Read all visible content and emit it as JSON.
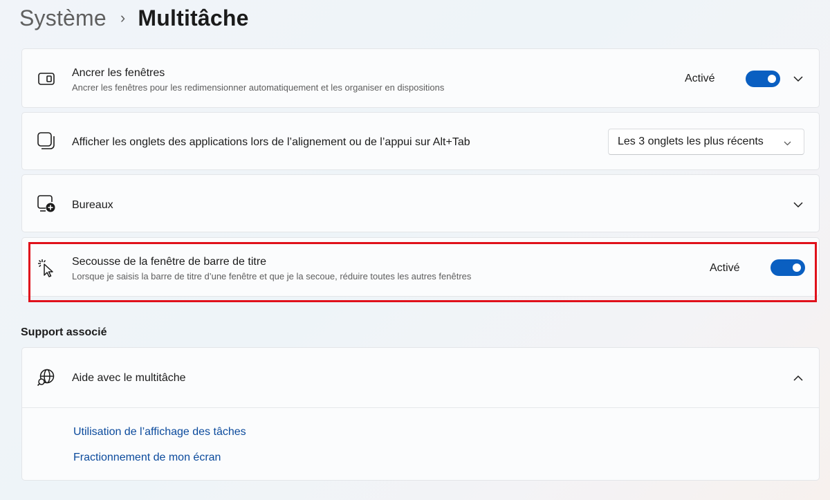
{
  "breadcrumb": {
    "parent": "Système",
    "separator": "›",
    "current": "Multitâche"
  },
  "settings": {
    "snap": {
      "title": "Ancrer les fenêtres",
      "description": "Ancrer les fenêtres pour les redimensionner automatiquement et les organiser en dispositions",
      "state": "Activé",
      "toggle_on": true,
      "icon": "snap-window-icon"
    },
    "tabs": {
      "title": "Afficher les onglets des applications lors de l’alignement ou de l’appui sur Alt+Tab",
      "dropdown_value": "Les 3 onglets les plus récents",
      "icon": "stacked-windows-icon"
    },
    "desktops": {
      "title": "Bureaux",
      "icon": "add-desktop-icon"
    },
    "shake": {
      "title": "Secousse de la fenêtre de barre de titre",
      "description": "Lorsque je saisis la barre de titre d’une fenêtre et que je la secoue, réduire toutes les autres fenêtres",
      "state": "Activé",
      "toggle_on": true,
      "icon": "cursor-shake-icon"
    }
  },
  "support": {
    "section_label": "Support associé",
    "title": "Aide avec le multitâche",
    "icon": "globe-search-icon",
    "links": [
      "Utilisation de l’affichage des tâches",
      "Fractionnement de mon écran"
    ]
  },
  "colors": {
    "accent": "#0a5fc1",
    "highlight": "#e0111b",
    "link": "#0b4a9c"
  }
}
